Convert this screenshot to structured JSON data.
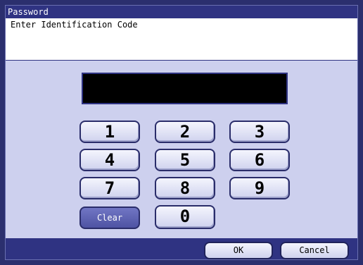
{
  "window": {
    "title": "Password"
  },
  "prompt": {
    "text": "Enter Identification Code"
  },
  "display": {
    "value": ""
  },
  "keypad": {
    "keys": [
      "1",
      "2",
      "3",
      "4",
      "5",
      "6",
      "7",
      "8",
      "9",
      "0"
    ],
    "clear_label": "Clear"
  },
  "footer": {
    "ok_label": "OK",
    "cancel_label": "Cancel"
  },
  "colors": {
    "frame": "#2b2f6e",
    "panel": "#cdd0ee",
    "title_bar": "#2f3382",
    "clear_button": "#5e63b3",
    "display": "#000000"
  }
}
